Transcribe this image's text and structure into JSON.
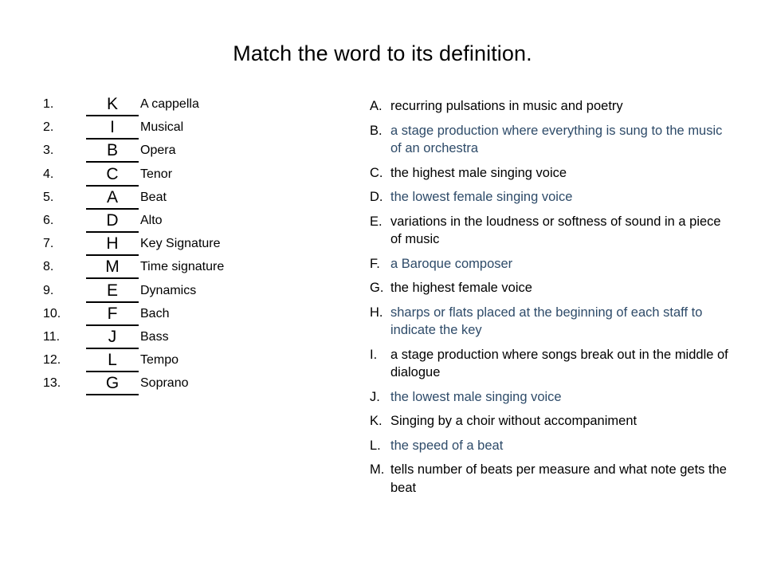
{
  "slide": {
    "title": "Match the word to its definition.",
    "accent_color": "#2e4b69",
    "text_color": "#000000",
    "background_color": "#ffffff"
  },
  "word_list": [
    {
      "number": "1.",
      "answer": "K",
      "term": "A cappella"
    },
    {
      "number": "2.",
      "answer": "I",
      "term": "Musical"
    },
    {
      "number": "3.",
      "answer": "B",
      "term": "Opera"
    },
    {
      "number": "4.",
      "answer": "C",
      "term": "Tenor"
    },
    {
      "number": "5.",
      "answer": "A",
      "term": "Beat"
    },
    {
      "number": "6.",
      "answer": "D",
      "term": "Alto"
    },
    {
      "number": "7.",
      "answer": "H",
      "term": "Key Signature"
    },
    {
      "number": "8.",
      "answer": "M",
      "term": "Time signature"
    },
    {
      "number": "9.",
      "answer": "E",
      "term": "Dynamics"
    },
    {
      "number": "10.",
      "answer": "F",
      "term": "Bach"
    },
    {
      "number": "11.",
      "answer": "J",
      "term": "Bass"
    },
    {
      "number": "12.",
      "answer": "L",
      "term": "Tempo"
    },
    {
      "number": "13.",
      "answer": "G",
      "term": "Soprano"
    }
  ],
  "definitions": [
    {
      "letter": "A.",
      "text": "recurring pulsations in music and poetry",
      "accent": false
    },
    {
      "letter": "B.",
      "text": "a stage production where everything is sung to the music of an orchestra",
      "accent": true
    },
    {
      "letter": "C.",
      "text": "the highest male singing voice",
      "accent": false
    },
    {
      "letter": "D.",
      "text": "the lowest female singing voice",
      "accent": true
    },
    {
      "letter": "E.",
      "text": "variations in the loudness or softness of sound in a piece of music",
      "accent": false
    },
    {
      "letter": "F.",
      "text": "a Baroque composer",
      "accent": true
    },
    {
      "letter": "G.",
      "text": "the highest female voice",
      "accent": false
    },
    {
      "letter": "H.",
      "text": "sharps or flats placed at the beginning of each staff to indicate the key",
      "accent": true
    },
    {
      "letter": "I.",
      "text": "a stage production where songs break out in the middle of dialogue",
      "accent": false
    },
    {
      "letter": "J.",
      "text": "the lowest male singing voice",
      "accent": true
    },
    {
      "letter": "K.",
      "text": "Singing by a choir without accompaniment",
      "accent": false
    },
    {
      "letter": "L.",
      "text": "the speed of a beat",
      "accent": true
    },
    {
      "letter": "M.",
      "text": "tells number of beats per measure and what note gets the beat",
      "accent": false
    }
  ]
}
